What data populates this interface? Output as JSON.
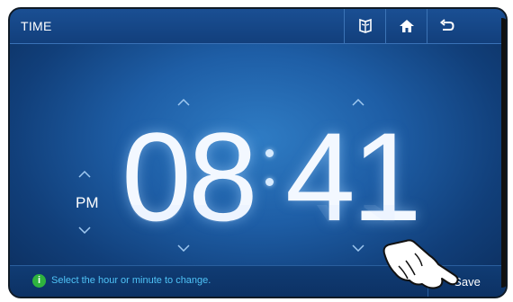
{
  "header": {
    "title": "TIME",
    "buttons": [
      {
        "name": "manual-icon",
        "label": ""
      },
      {
        "name": "home-icon",
        "label": ""
      },
      {
        "name": "back-icon",
        "label": ""
      }
    ]
  },
  "clock": {
    "hour": "08",
    "minute": "41",
    "period": "PM"
  },
  "footer": {
    "hint": "Select the hour or minute to change.",
    "save_label": "Save"
  },
  "colors": {
    "header_bg": "#123f7c",
    "screen_bg": "#1e5ea6",
    "hint_text": "#4fc3f7",
    "info_green": "#2fb33e"
  }
}
